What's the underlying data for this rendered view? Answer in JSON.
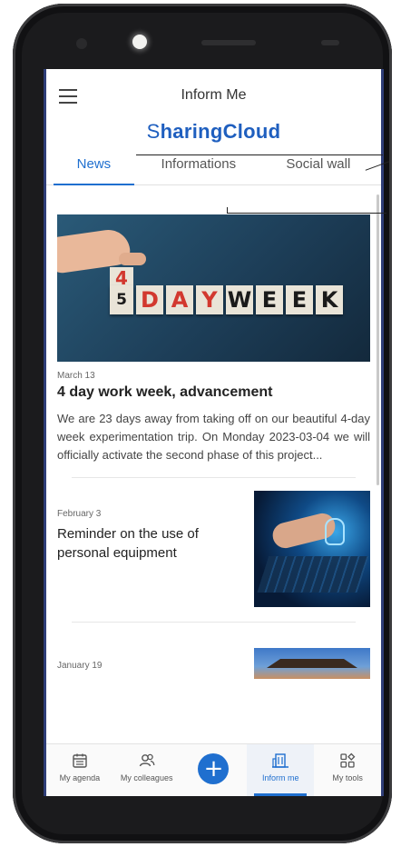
{
  "app": {
    "title": "Inform Me",
    "brand": "SharingCloud",
    "brand_s": "S",
    "brand_rest": "haringCloud"
  },
  "tabs": [
    {
      "label": "News",
      "active": true
    },
    {
      "label": "Informations",
      "active": false
    },
    {
      "label": "Social wall",
      "active": false
    }
  ],
  "feed": {
    "featured": {
      "image_text": {
        "top_digit": "4",
        "digit": "5",
        "word": [
          "D",
          "A",
          "Y",
          "W",
          "E",
          "E",
          "K"
        ]
      },
      "date": "March 13",
      "title": "4 day work week, advancement",
      "excerpt": "We are 23 days away from taking off on our beautiful 4-day week experimentation trip. On Monday 2023-03-04 we will officially activate the second phase of this project..."
    },
    "items": [
      {
        "date": "February 3",
        "title": "Reminder on the use of personal equipment"
      },
      {
        "date": "January 19",
        "title": ""
      }
    ]
  },
  "bottom_nav": [
    {
      "label": "My agenda",
      "icon": "calendar-icon"
    },
    {
      "label": "My colleagues",
      "icon": "people-icon"
    },
    {
      "label": "",
      "icon": "plus-icon"
    },
    {
      "label": "Inform me",
      "icon": "building-icon",
      "active": true
    },
    {
      "label": "My tools",
      "icon": "tools-grid-icon"
    }
  ],
  "colors": {
    "accent": "#1f6fcf",
    "brand": "#1f5fbf",
    "frame": "#1b1b1d",
    "highlight_red": "#d2382f"
  }
}
